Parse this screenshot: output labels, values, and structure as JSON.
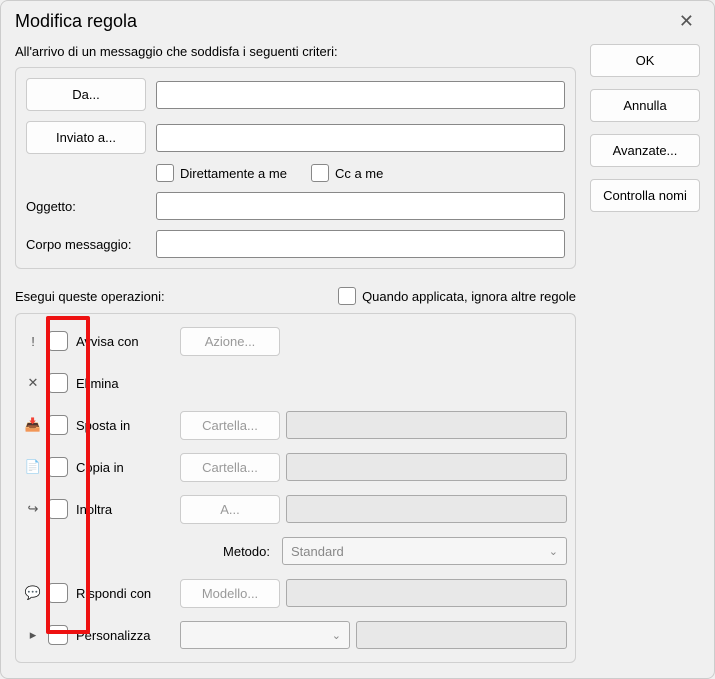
{
  "window": {
    "title": "Modifica regola"
  },
  "intro": "All'arrivo di un messaggio che soddisfa i seguenti criteri:",
  "criteria": {
    "from_btn": "Da...",
    "sent_to_btn": "Inviato a...",
    "direct_to_me": "Direttamente a me",
    "cc_to_me": "Cc a me",
    "subject_label": "Oggetto:",
    "body_label": "Corpo messaggio:"
  },
  "ops_intro": "Esegui queste operazioni:",
  "ignore_other": "Quando applicata, ignora altre regole",
  "ops": {
    "alert": {
      "label": "Avvisa con",
      "btn": "Azione..."
    },
    "delete": {
      "label": "Elimina"
    },
    "move": {
      "label": "Sposta in",
      "btn": "Cartella..."
    },
    "copy": {
      "label": "Copia in",
      "btn": "Cartella..."
    },
    "forward": {
      "label": "Inoltra",
      "btn": "A..."
    },
    "method_label": "Metodo:",
    "method_value": "Standard",
    "reply": {
      "label": "Rispondi con",
      "btn": "Modello..."
    },
    "custom": {
      "label": "Personalizza"
    }
  },
  "buttons": {
    "ok": "OK",
    "cancel": "Annulla",
    "advanced": "Avanzate...",
    "check_names": "Controlla nomi"
  }
}
